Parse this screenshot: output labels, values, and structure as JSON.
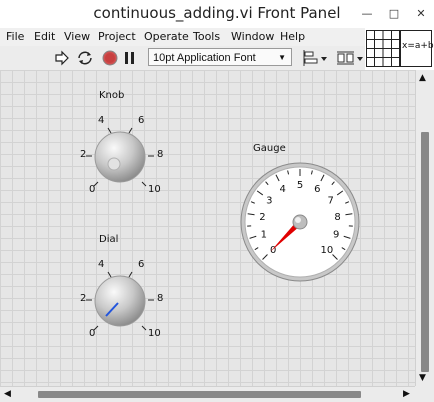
{
  "window": {
    "title": "continuous_adding.vi Front Panel",
    "minimize_icon": "minimize-icon",
    "maximize_icon": "maximize-icon",
    "close_icon": "close-icon"
  },
  "menu": {
    "items": [
      "File",
      "Edit",
      "View",
      "Project",
      "Operate",
      "Tools",
      "Window",
      "Help"
    ]
  },
  "toolbar": {
    "run_icon": "run-arrow-icon",
    "run_continuously_icon": "run-continuously-icon",
    "abort_icon": "abort-stop-icon",
    "pause_icon": "pause-icon",
    "font": "10pt Application Font",
    "align_icon": "align-objects-icon",
    "distribute_icon": "distribute-objects-icon"
  },
  "connector": {
    "expression": "x=a+b"
  },
  "controls": {
    "knob": {
      "label": "Knob",
      "min": 0,
      "max": 10,
      "value": 0,
      "ticks": [
        "0",
        "2",
        "4",
        "6",
        "8",
        "10"
      ]
    },
    "dial": {
      "label": "Dial",
      "min": 0,
      "max": 10,
      "value": 0,
      "ticks": [
        "0",
        "2",
        "4",
        "6",
        "8",
        "10"
      ]
    },
    "gauge": {
      "label": "Gauge",
      "min": 0,
      "max": 10,
      "value": 0,
      "ticks": [
        "0",
        "1",
        "2",
        "3",
        "4",
        "5",
        "6",
        "7",
        "8",
        "9",
        "10"
      ],
      "needle_color": "#e00000"
    }
  },
  "colors": {
    "dial_pointer": "#2255dd",
    "gauge_needle": "#e00000"
  }
}
